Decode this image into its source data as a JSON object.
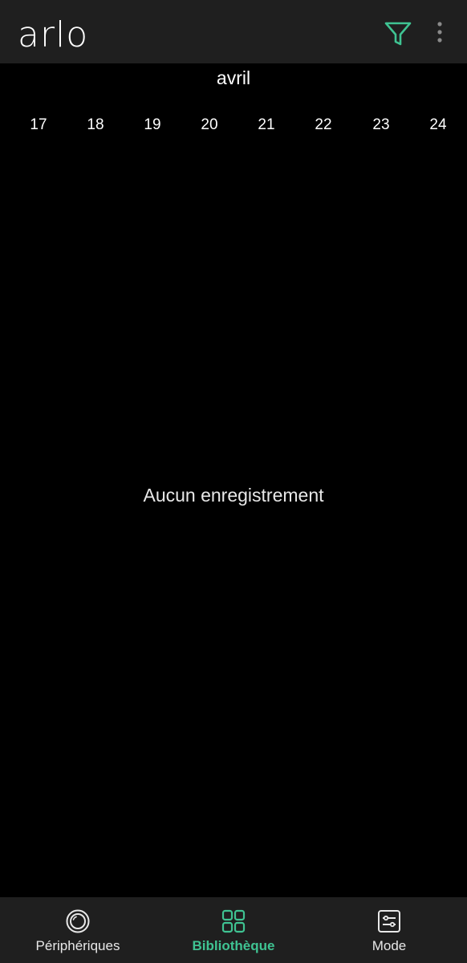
{
  "header": {
    "logo_text": "arlo",
    "filter_icon": "filter-icon",
    "more_icon": "more-vertical-icon",
    "accent_color": "#3fc392"
  },
  "calendar": {
    "month": "avril",
    "days": [
      "17",
      "18",
      "19",
      "20",
      "21",
      "22",
      "23",
      "24"
    ]
  },
  "main": {
    "empty_message": "Aucun enregistrement"
  },
  "bottom_nav": {
    "items": [
      {
        "label": "Périphériques",
        "icon": "camera-icon",
        "active": false
      },
      {
        "label": "Bibliothèque",
        "icon": "grid-icon",
        "active": true
      },
      {
        "label": "Mode",
        "icon": "sliders-icon",
        "active": false
      }
    ]
  }
}
